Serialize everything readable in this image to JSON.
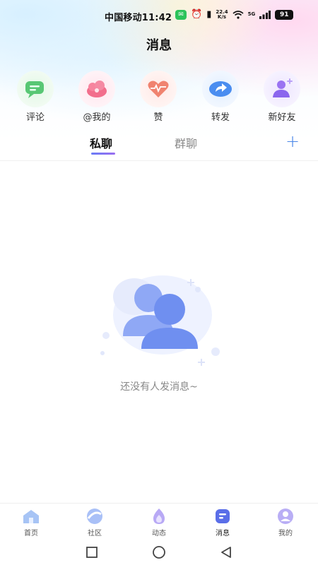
{
  "status_bar": {
    "carrier_time": "中国移动11:42",
    "net_speed_top": "22.4",
    "net_speed_bottom": "K/s",
    "network": "5G",
    "battery": "91"
  },
  "header": {
    "title": "消息"
  },
  "shortcuts": [
    {
      "label": "评论",
      "icon": "comment-icon",
      "color": "#4cc36a"
    },
    {
      "label": "@我的",
      "icon": "mention-icon",
      "color": "#f06a8a"
    },
    {
      "label": "赞",
      "icon": "like-icon",
      "color": "#f07a6a"
    },
    {
      "label": "转发",
      "icon": "share-icon",
      "color": "#4a8cf0"
    },
    {
      "label": "新好友",
      "icon": "new-friend-icon",
      "color": "#8a6af0"
    }
  ],
  "tabs": {
    "private_chat": "私聊",
    "group_chat": "群聊",
    "add": "+"
  },
  "empty_state": {
    "text": "还没有人发消息~"
  },
  "bottom_nav": [
    {
      "label": "首页",
      "icon": "home-icon"
    },
    {
      "label": "社区",
      "icon": "community-icon"
    },
    {
      "label": "动态",
      "icon": "moments-icon"
    },
    {
      "label": "消息",
      "icon": "message-icon",
      "active": true
    },
    {
      "label": "我的",
      "icon": "profile-icon"
    }
  ]
}
